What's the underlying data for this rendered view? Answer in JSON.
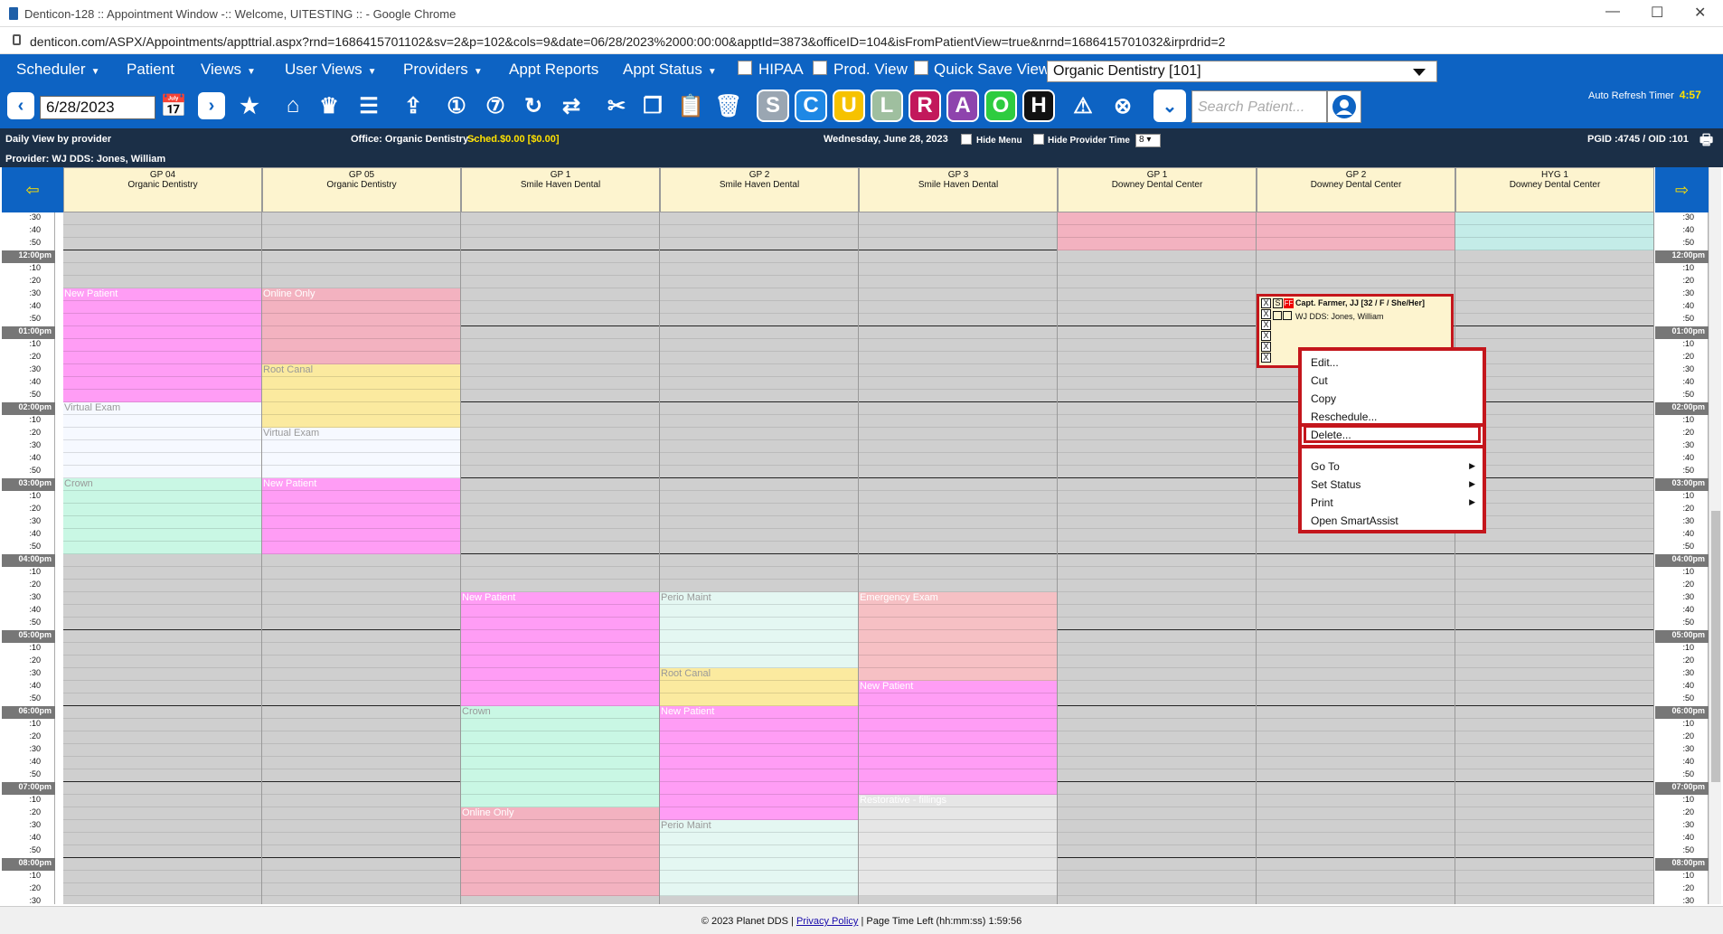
{
  "window": {
    "title": "Denticon-128 :: Appointment Window -:: Welcome, UITESTING :: - Google Chrome",
    "url": "denticon.com/ASPX/Appointments/appttrial.aspx?rnd=1686415701102&sv=2&p=102&cols=9&date=06/28/2023%2000:00:00&apptId=3873&officeID=104&isFromPatientView=true&nrnd=1686415701032&irprdrid=2"
  },
  "menu": {
    "items": [
      "Scheduler",
      "Patient",
      "Views",
      "User Views",
      "Providers",
      "Appt Reports",
      "Appt Status"
    ],
    "hipaa": "HIPAA",
    "prod_view": "Prod. View",
    "quick_save": "Quick Save View",
    "office": "Organic Dentistry [101]"
  },
  "toolbar": {
    "date": "6/28/2023",
    "search_placeholder": "Search Patient...",
    "letters": [
      "S",
      "C",
      "U",
      "L",
      "R",
      "A",
      "O",
      "H"
    ],
    "letter_colors": [
      "#9aa6b2",
      "#1e88e5",
      "#f6c200",
      "#9fbf9f",
      "#c2185b",
      "#8e44ad",
      "#2ecc40",
      "#111111"
    ],
    "refresh_label": "Auto Refresh Timer",
    "refresh_value": "4:57"
  },
  "info": {
    "view": "Daily View by provider",
    "office": "Office: Organic Dentistry -",
    "sched": "Sched.$0.00 [$0.00]",
    "date": "Wednesday, June 28, 2023",
    "hide_menu": "Hide Menu",
    "hide_provider": "Hide Provider Time",
    "interval": "8",
    "pgid": "PGID :4745  /  OID :101",
    "provider": "Provider: WJ DDS: Jones, William"
  },
  "columns": [
    {
      "code": "GP 04",
      "office": "Organic Dentistry"
    },
    {
      "code": "GP 05",
      "office": "Organic Dentistry"
    },
    {
      "code": "GP 1",
      "office": "Smile Haven Dental"
    },
    {
      "code": "GP 2",
      "office": "Smile Haven Dental"
    },
    {
      "code": "GP 3",
      "office": "Smile Haven Dental"
    },
    {
      "code": "GP 1",
      "office": "Downey Dental Center"
    },
    {
      "code": "GP 2",
      "office": "Downey Dental Center"
    },
    {
      "code": "HYG 1",
      "office": "Downey Dental Center"
    }
  ],
  "time_labels": [
    ":30",
    ":40",
    ":50",
    "12:00pm",
    ":10",
    ":20",
    ":30",
    ":40",
    ":50",
    "01:00pm",
    ":10",
    ":20",
    ":30",
    ":40",
    ":50",
    "02:00pm",
    ":10",
    ":20",
    ":30",
    ":40",
    ":50",
    "03:00pm",
    ":10",
    ":20",
    ":30",
    ":40",
    ":50",
    "04:00pm",
    ":10",
    ":20",
    ":30",
    ":40",
    ":50",
    "05:00pm",
    ":10",
    ":20",
    ":30",
    ":40",
    ":50",
    "06:00pm",
    ":10",
    ":20",
    ":30",
    ":40",
    ":50",
    "07:00pm",
    ":10",
    ":20",
    ":30",
    ":40",
    ":50",
    "08:00pm",
    ":10",
    ":20",
    ":30"
  ],
  "appointments": [
    {
      "col": 0,
      "start": 6,
      "span": 9,
      "label": "New Patient",
      "color": "#ff9df5"
    },
    {
      "col": 0,
      "start": 15,
      "span": 6,
      "label": "Virtual Exam",
      "color": "#f6f9ff",
      "dark": true
    },
    {
      "col": 0,
      "start": 21,
      "span": 6,
      "label": "Crown",
      "color": "#c9f7e4",
      "dark": true
    },
    {
      "col": 1,
      "start": 6,
      "span": 6,
      "label": "Online Only",
      "color": "#f3b2c0"
    },
    {
      "col": 1,
      "start": 12,
      "span": 3,
      "label": "Root Canal",
      "color": "#fbea9f",
      "dark": true
    },
    {
      "col": 1,
      "start": 15,
      "span": 2,
      "label": "",
      "color": "#fbea9f"
    },
    {
      "col": 1,
      "start": 17,
      "span": 4,
      "label": "Virtual Exam",
      "color": "#f6f9ff",
      "dark": true
    },
    {
      "col": 1,
      "start": 21,
      "span": 6,
      "label": "New Patient",
      "color": "#ff9df5"
    },
    {
      "col": 2,
      "start": 30,
      "span": 9,
      "label": "New Patient",
      "color": "#ff9df5"
    },
    {
      "col": 2,
      "start": 39,
      "span": 8,
      "label": "Crown",
      "color": "#c9f7e4",
      "dark": true
    },
    {
      "col": 2,
      "start": 47,
      "span": 7,
      "label": "Online Only",
      "color": "#f3b2c0"
    },
    {
      "col": 3,
      "start": 30,
      "span": 6,
      "label": "Perio Maint",
      "color": "#e4f7f2",
      "dark": true
    },
    {
      "col": 3,
      "start": 36,
      "span": 3,
      "label": "Root Canal",
      "color": "#fbea9f",
      "dark": true
    },
    {
      "col": 3,
      "start": 39,
      "span": 9,
      "label": "New Patient",
      "color": "#ff9df5"
    },
    {
      "col": 3,
      "start": 48,
      "span": 6,
      "label": "Perio Maint",
      "color": "#e4f7f2",
      "dark": true
    },
    {
      "col": 4,
      "start": 30,
      "span": 7,
      "label": "Emergency Exam",
      "color": "#f6c0c4"
    },
    {
      "col": 4,
      "start": 37,
      "span": 9,
      "label": "New Patient",
      "color": "#ff9df5"
    },
    {
      "col": 4,
      "start": 46,
      "span": 8,
      "label": "Restorative - fillings",
      "color": "#e6e6e6"
    },
    {
      "col": 5,
      "start": 0,
      "span": 3,
      "label": "",
      "color": "#f3b2c0"
    },
    {
      "col": 6,
      "start": 0,
      "span": 3,
      "label": "",
      "color": "#f3b2c0"
    },
    {
      "col": 7,
      "start": 0,
      "span": 3,
      "label": "",
      "color": "#c4ece8"
    }
  ],
  "selected_appt": {
    "patient": "Capt. Farmer, JJ [32 / F / She/Her]",
    "provider": "WJ DDS: Jones, William"
  },
  "context_menu": {
    "edit": "Edit...",
    "cut": "Cut",
    "copy": "Copy",
    "reschedule": "Reschedule...",
    "delete": "Delete...",
    "goto": "Go To",
    "set_status": "Set Status",
    "print": "Print",
    "smartassist": "Open SmartAssist"
  },
  "footer": {
    "copy": "© 2023 Planet DDS |",
    "privacy": "Privacy Policy",
    "time_left": "| Page Time Left (hh:mm:ss) 1:59:56"
  }
}
